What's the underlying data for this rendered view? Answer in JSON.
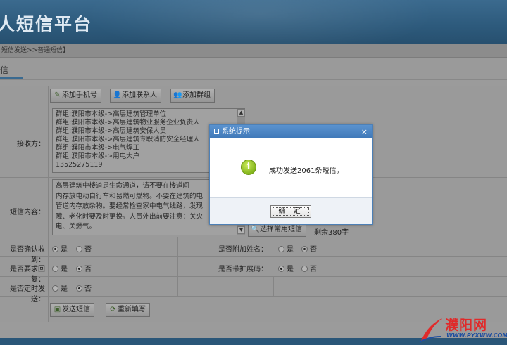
{
  "header": {
    "title": "人短信平台"
  },
  "breadcrumb": "短信发送>>普通短信】",
  "tab": {
    "label": "信"
  },
  "toolbar": {
    "add_phone": "添加手机号",
    "add_contact": "添加联系人",
    "add_group": "添加群组"
  },
  "receivers": {
    "label": "接收方：",
    "lines": [
      "群组:濮阳市本级->高层建筑管理单位",
      "群组:濮阳市本级->高层建筑物业服务企业负责人",
      "群组:濮阳市本级->高层建筑安保人员",
      "群组:濮阳市本级->高层建筑专职消防安全经理人",
      "群组:濮阳市本级->电气焊工",
      "群组:濮阳市本级->用电大户",
      "13525275119"
    ]
  },
  "content": {
    "label": "短信内容：",
    "lines": [
      "      高层建筑中楼道是生命通道，请不要在楼道间",
      "内存放电动自行车和易燃可燃物。不要在建筑的电",
      "管道内存放杂物。要经常检查家中电气线路，发现",
      "障、老化时要及时更换。人员外出前要注意：关火",
      "电、关燃气。"
    ],
    "select_common_button": "选择常用短信",
    "remaining": "剩余380字"
  },
  "options": {
    "confirm_receipt": {
      "label": "是否确认收到：",
      "yes": "是",
      "no": "否",
      "selected": "yes"
    },
    "append_name": {
      "label": "是否附加姓名：",
      "yes": "是",
      "no": "否",
      "selected": "no"
    },
    "require_reply": {
      "label": "是否要求回复：",
      "yes": "是",
      "no": "否",
      "selected": "no"
    },
    "ext_code": {
      "label": "是否带扩展码：",
      "yes": "是",
      "no": "否",
      "selected": "yes"
    },
    "scheduled": {
      "label": "是否定时发送：",
      "yes": "是",
      "no": "否",
      "selected": "no"
    }
  },
  "actions": {
    "send": "发送短信",
    "refill": "重新填写"
  },
  "dialog": {
    "title": "系统提示",
    "close": "×",
    "message": "成功发送2061条短信。",
    "ok": "确 定"
  },
  "logo": {
    "name": "濮阳网",
    "url": "WWW.PYXWW.COM"
  },
  "colors": {
    "header": "#2d5a7c",
    "dialog_title": "#4a84c4",
    "logo_red": "#e02a2a"
  }
}
